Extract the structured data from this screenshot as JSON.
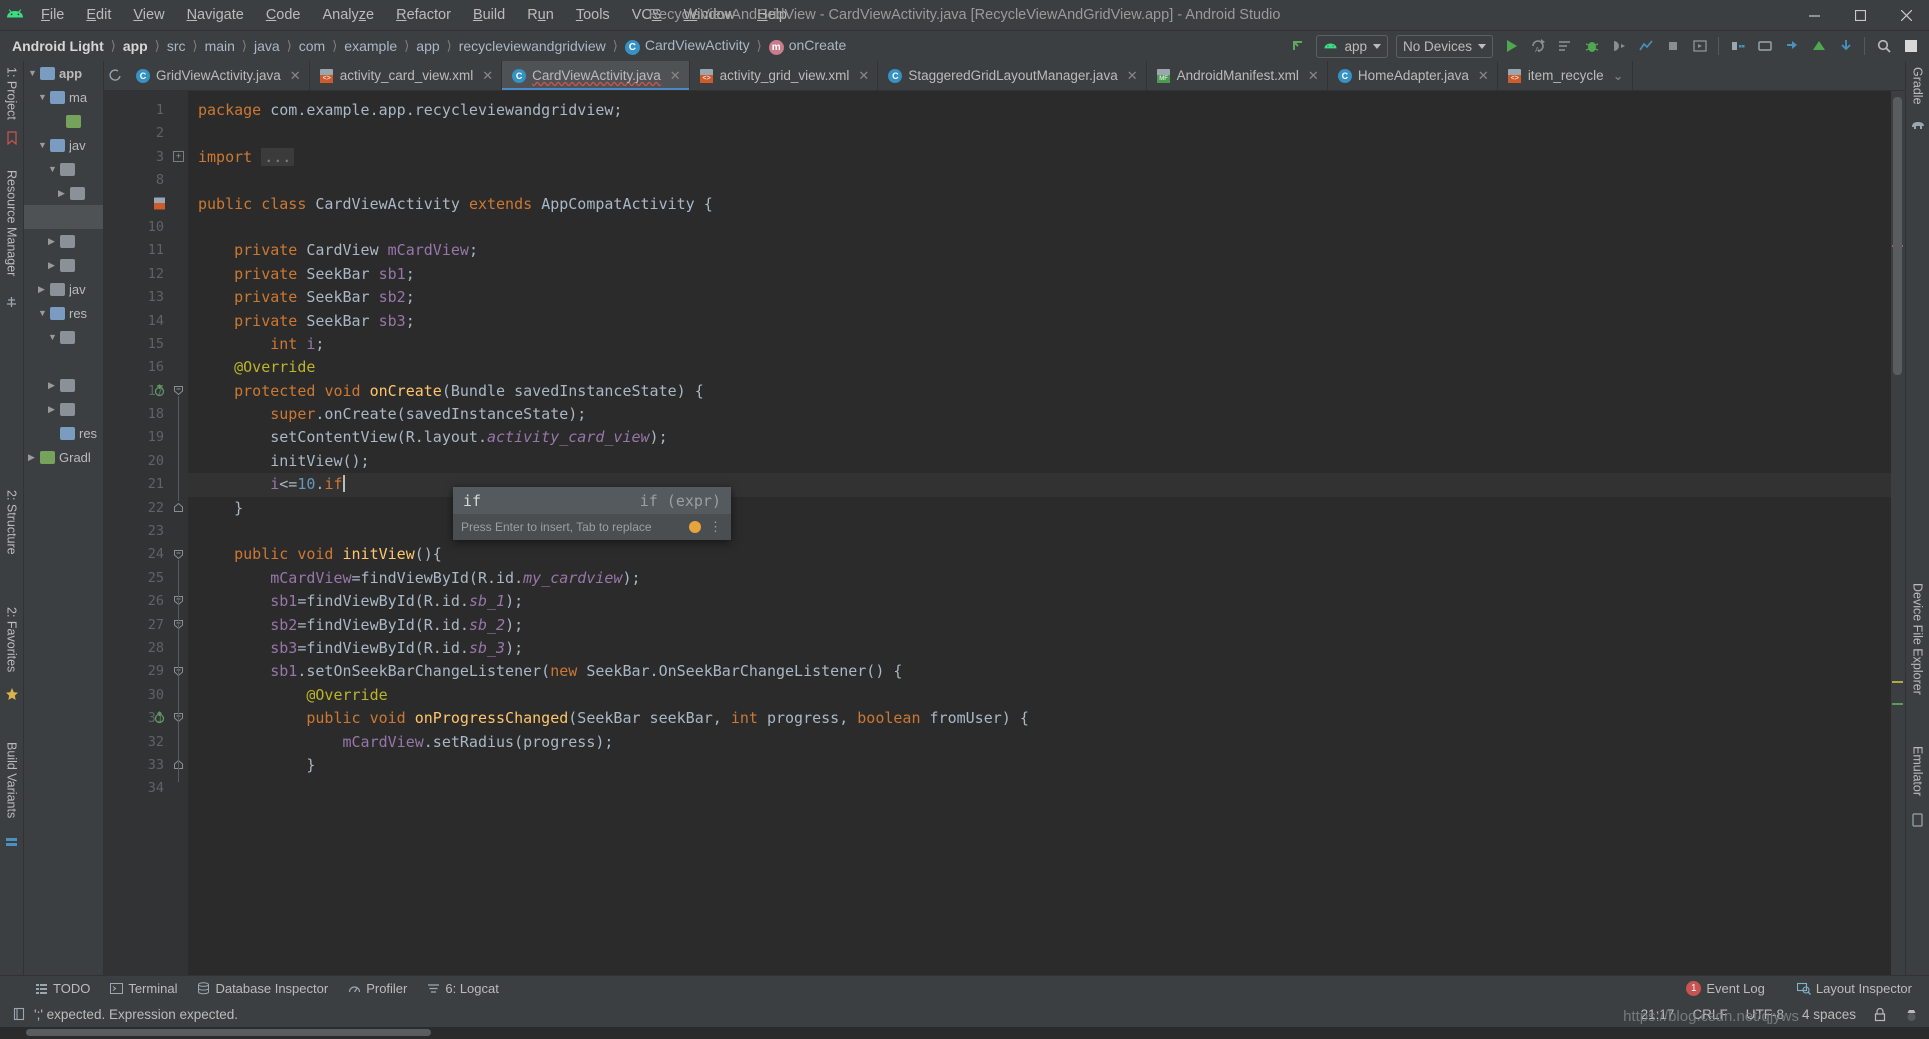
{
  "window": {
    "title": "RecycleViewAndGridView - CardViewActivity.java [RecycleViewAndGridView.app] - Android Studio",
    "minimize": "—",
    "maximize": "☐",
    "close": "✕"
  },
  "menu": {
    "items": [
      {
        "label": "File",
        "mnemonic": "F"
      },
      {
        "label": "Edit",
        "mnemonic": "E"
      },
      {
        "label": "View",
        "mnemonic": "V"
      },
      {
        "label": "Navigate",
        "mnemonic": "N"
      },
      {
        "label": "Code",
        "mnemonic": "C"
      },
      {
        "label": "Analyze",
        "mnemonic": "z"
      },
      {
        "label": "Refactor",
        "mnemonic": "R"
      },
      {
        "label": "Build",
        "mnemonic": "B"
      },
      {
        "label": "Run",
        "mnemonic": "u"
      },
      {
        "label": "Tools",
        "mnemonic": "T"
      },
      {
        "label": "VCS",
        "mnemonic": "S"
      },
      {
        "label": "Window",
        "mnemonic": "W"
      },
      {
        "label": "Help",
        "mnemonic": "H"
      }
    ]
  },
  "breadcrumb": {
    "items": [
      {
        "label": "Android Light",
        "style": "bold"
      },
      {
        "label": "app",
        "style": "bold"
      },
      {
        "label": "src",
        "style": "dim"
      },
      {
        "label": "main",
        "style": "dim"
      },
      {
        "label": "java",
        "style": "dim"
      },
      {
        "label": "com",
        "style": "dim"
      },
      {
        "label": "example",
        "style": "dim"
      },
      {
        "label": "app",
        "style": "dim"
      },
      {
        "label": "recycleviewandgridview",
        "style": "dim"
      },
      {
        "label": "CardViewActivity",
        "style": "dim",
        "icon": "class-icon",
        "icon_glyph": "C"
      },
      {
        "label": "onCreate",
        "style": "dim",
        "icon": "method-icon",
        "icon_glyph": "m"
      }
    ],
    "separator": "〉"
  },
  "toolbar": {
    "module_selector": "app",
    "device_selector": "No Devices",
    "icons": [
      "run-icon",
      "apply-changes-icon",
      "apply-code-changes-icon",
      "debug-icon",
      "attach-debugger-icon",
      "profile-icon",
      "stop-icon",
      "sdk-manager-icon",
      "avd-manager-icon",
      "layout-inspector-icon",
      "sync-gradle-icon",
      "avd-icon",
      "device-explorer-icon",
      "search-everywhere-icon",
      "project-structure-icon"
    ]
  },
  "left_tool_strips": {
    "top": [
      "1: Project"
    ],
    "items": [
      "Resource Manager",
      "2: Structure",
      "2: Favorites",
      "Build Variants"
    ]
  },
  "right_tool_strips": {
    "items": [
      "Gradle",
      "Device File Explorer",
      "Emulator"
    ]
  },
  "project_tree": [
    {
      "label": "app",
      "depth": 0,
      "arrow": "▼",
      "bold": true,
      "folder": "blue"
    },
    {
      "label": "ma",
      "depth": 1,
      "arrow": "▼",
      "folder": "blue"
    },
    {
      "label": "",
      "depth": 2,
      "arrow": "",
      "folder": "green"
    },
    {
      "label": "jav",
      "depth": 1,
      "arrow": "▼",
      "folder": "blue"
    },
    {
      "label": "",
      "depth": 2,
      "arrow": "▼",
      "folder": "plain"
    },
    {
      "label": "",
      "depth": 3,
      "arrow": "▶",
      "folder": "plain"
    },
    {
      "label": "",
      "depth": 2,
      "arrow": "▶",
      "folder": "plain"
    },
    {
      "label": "",
      "depth": 2,
      "arrow": "▶",
      "folder": "plain"
    },
    {
      "label": "jav",
      "depth": 1,
      "arrow": "▶",
      "folder": "plain"
    },
    {
      "label": "res",
      "depth": 1,
      "arrow": "▼",
      "folder": "blue"
    },
    {
      "label": "",
      "depth": 2,
      "arrow": "▼",
      "folder": "plain"
    },
    {
      "label": "",
      "depth": 3,
      "arrow": "",
      "folder": "plain"
    },
    {
      "label": "",
      "depth": 2,
      "arrow": "▶",
      "folder": "plain"
    },
    {
      "label": "",
      "depth": 2,
      "arrow": "▶",
      "folder": "plain"
    },
    {
      "label": "res",
      "depth": 1,
      "arrow": "",
      "folder": "blue"
    },
    {
      "label": "Gradl",
      "depth": 0,
      "arrow": "▶",
      "folder": "gradle"
    }
  ],
  "editor_tabs": [
    {
      "label": "GridViewActivity.java",
      "icon": "java-class-icon",
      "active": false,
      "error": false
    },
    {
      "label": "activity_card_view.xml",
      "icon": "xml-layout-icon",
      "active": false,
      "error": false
    },
    {
      "label": "CardViewActivity.java",
      "icon": "java-class-icon",
      "active": true,
      "error": true
    },
    {
      "label": "activity_grid_view.xml",
      "icon": "xml-layout-icon",
      "active": false,
      "error": false
    },
    {
      "label": "StaggeredGridLayoutManager.java",
      "icon": "java-class-icon",
      "active": false,
      "error": false
    },
    {
      "label": "AndroidManifest.xml",
      "icon": "manifest-icon",
      "active": false,
      "error": false
    },
    {
      "label": "HomeAdapter.java",
      "icon": "java-class-icon",
      "active": false,
      "error": false
    },
    {
      "label": "item_recycle",
      "icon": "xml-layout-icon",
      "active": false,
      "error": false,
      "truncated": true
    }
  ],
  "code": {
    "filename": "CardViewActivity.java",
    "lines": [
      {
        "n": 1,
        "tokens": [
          {
            "t": "package ",
            "c": "kw"
          },
          {
            "t": "com.example.app.recycleviewandgridview;",
            "c": "pl"
          }
        ]
      },
      {
        "n": 2,
        "tokens": []
      },
      {
        "n": 3,
        "tokens": [
          {
            "t": "import ",
            "c": "kw"
          },
          {
            "t": "...",
            "c": "imp"
          }
        ],
        "fold": "collapsed"
      },
      {
        "n": 8,
        "tokens": []
      },
      {
        "n": 9,
        "tokens": [
          {
            "t": "public ",
            "c": "kw"
          },
          {
            "t": "class ",
            "c": "kw"
          },
          {
            "t": "CardViewActivity ",
            "c": "cls"
          },
          {
            "t": "extends ",
            "c": "kw"
          },
          {
            "t": "AppCompatActivity {",
            "c": "cls"
          }
        ],
        "gutter_icon": "layout-file-icon"
      },
      {
        "n": 10,
        "tokens": []
      },
      {
        "n": 11,
        "tokens": [
          {
            "t": "    ",
            "c": "pl"
          },
          {
            "t": "private ",
            "c": "kw"
          },
          {
            "t": "CardView ",
            "c": "cls"
          },
          {
            "t": "mCardView",
            "c": "fld"
          },
          {
            "t": ";",
            "c": "pl"
          }
        ]
      },
      {
        "n": 12,
        "tokens": [
          {
            "t": "    ",
            "c": "pl"
          },
          {
            "t": "private ",
            "c": "kw"
          },
          {
            "t": "SeekBar ",
            "c": "cls"
          },
          {
            "t": "sb1",
            "c": "fld"
          },
          {
            "t": ";",
            "c": "pl"
          }
        ]
      },
      {
        "n": 13,
        "tokens": [
          {
            "t": "    ",
            "c": "pl"
          },
          {
            "t": "private ",
            "c": "kw"
          },
          {
            "t": "SeekBar ",
            "c": "cls"
          },
          {
            "t": "sb2",
            "c": "fld"
          },
          {
            "t": ";",
            "c": "pl"
          }
        ]
      },
      {
        "n": 14,
        "tokens": [
          {
            "t": "    ",
            "c": "pl"
          },
          {
            "t": "private ",
            "c": "kw"
          },
          {
            "t": "SeekBar ",
            "c": "cls"
          },
          {
            "t": "sb3",
            "c": "fld"
          },
          {
            "t": ";",
            "c": "pl"
          }
        ]
      },
      {
        "n": 15,
        "tokens": [
          {
            "t": "        ",
            "c": "pl"
          },
          {
            "t": "int ",
            "c": "kw"
          },
          {
            "t": "i",
            "c": "fld"
          },
          {
            "t": ";",
            "c": "pl"
          }
        ]
      },
      {
        "n": 16,
        "tokens": [
          {
            "t": "    ",
            "c": "pl"
          },
          {
            "t": "@Override",
            "c": "ann"
          }
        ]
      },
      {
        "n": 17,
        "tokens": [
          {
            "t": "    ",
            "c": "pl"
          },
          {
            "t": "protected ",
            "c": "kw"
          },
          {
            "t": "void ",
            "c": "kw"
          },
          {
            "t": "onCreate",
            "c": "mth"
          },
          {
            "t": "(Bundle savedInstanceState) {",
            "c": "pl"
          }
        ],
        "gutter_icon": "override-method-icon",
        "fold": "open"
      },
      {
        "n": 18,
        "tokens": [
          {
            "t": "        ",
            "c": "pl"
          },
          {
            "t": "super",
            "c": "kw"
          },
          {
            "t": ".onCreate(savedInstanceState);",
            "c": "pl"
          }
        ]
      },
      {
        "n": 19,
        "tokens": [
          {
            "t": "        setContentView(R.layout.",
            "c": "pl"
          },
          {
            "t": "activity_card_view",
            "c": "fldi"
          },
          {
            "t": ");",
            "c": "pl"
          }
        ]
      },
      {
        "n": 20,
        "tokens": [
          {
            "t": "        initView();",
            "c": "pl"
          }
        ]
      },
      {
        "n": 21,
        "tokens": [
          {
            "t": "        ",
            "c": "pl"
          },
          {
            "t": "i",
            "c": "fld"
          },
          {
            "t": "<=",
            "c": "pl"
          },
          {
            "t": "10",
            "c": "num"
          },
          {
            "t": ".",
            "c": "pl"
          },
          {
            "t": "if",
            "c": "kw"
          }
        ],
        "current": true
      },
      {
        "n": 22,
        "tokens": [
          {
            "t": "    }",
            "c": "pl"
          }
        ],
        "fold": "close"
      },
      {
        "n": 23,
        "tokens": []
      },
      {
        "n": 24,
        "tokens": [
          {
            "t": "    ",
            "c": "pl"
          },
          {
            "t": "public ",
            "c": "kw"
          },
          {
            "t": "void ",
            "c": "kw"
          },
          {
            "t": "initView",
            "c": "mth"
          },
          {
            "t": "(){",
            "c": "pl"
          }
        ],
        "fold": "open"
      },
      {
        "n": 25,
        "tokens": [
          {
            "t": "        ",
            "c": "pl"
          },
          {
            "t": "mCardView",
            "c": "fld"
          },
          {
            "t": "=findViewById(R.id.",
            "c": "pl"
          },
          {
            "t": "my_cardview",
            "c": "fldi"
          },
          {
            "t": ");",
            "c": "pl"
          }
        ]
      },
      {
        "n": 26,
        "tokens": [
          {
            "t": "        ",
            "c": "pl"
          },
          {
            "t": "sb1",
            "c": "fld"
          },
          {
            "t": "=findViewById(R.id.",
            "c": "pl"
          },
          {
            "t": "sb_1",
            "c": "fldi"
          },
          {
            "t": ");",
            "c": "pl"
          }
        ],
        "fold": "open"
      },
      {
        "n": 27,
        "tokens": [
          {
            "t": "        ",
            "c": "pl"
          },
          {
            "t": "sb2",
            "c": "fld"
          },
          {
            "t": "=findViewById(R.id.",
            "c": "pl"
          },
          {
            "t": "sb_2",
            "c": "fldi"
          },
          {
            "t": ");",
            "c": "pl"
          }
        ],
        "fold": "open"
      },
      {
        "n": 28,
        "tokens": [
          {
            "t": "        ",
            "c": "pl"
          },
          {
            "t": "sb3",
            "c": "fld"
          },
          {
            "t": "=findViewById(R.id.",
            "c": "pl"
          },
          {
            "t": "sb_3",
            "c": "fldi"
          },
          {
            "t": ");",
            "c": "pl"
          }
        ]
      },
      {
        "n": 29,
        "tokens": [
          {
            "t": "        ",
            "c": "pl"
          },
          {
            "t": "sb1",
            "c": "fld"
          },
          {
            "t": ".setOnSeekBarChangeListener(",
            "c": "pl"
          },
          {
            "t": "new ",
            "c": "kw"
          },
          {
            "t": "SeekBar.OnSeekBarChangeListener() {",
            "c": "pl"
          }
        ],
        "fold": "open"
      },
      {
        "n": 30,
        "tokens": [
          {
            "t": "            ",
            "c": "pl"
          },
          {
            "t": "@Override",
            "c": "ann"
          }
        ]
      },
      {
        "n": 31,
        "tokens": [
          {
            "t": "            ",
            "c": "pl"
          },
          {
            "t": "public ",
            "c": "kw"
          },
          {
            "t": "void ",
            "c": "kw"
          },
          {
            "t": "onProgressChanged",
            "c": "mth"
          },
          {
            "t": "(SeekBar seekBar, ",
            "c": "pl"
          },
          {
            "t": "int ",
            "c": "kw"
          },
          {
            "t": "progress, ",
            "c": "pl"
          },
          {
            "t": "boolean ",
            "c": "kw"
          },
          {
            "t": "fromUser) {",
            "c": "pl"
          }
        ],
        "gutter_icon": "override-method-icon",
        "fold": "open"
      },
      {
        "n": 32,
        "tokens": [
          {
            "t": "                ",
            "c": "pl"
          },
          {
            "t": "mCardView",
            "c": "fld"
          },
          {
            "t": ".setRadius(progress);",
            "c": "pl"
          }
        ]
      },
      {
        "n": 33,
        "tokens": [
          {
            "t": "            }",
            "c": "pl"
          }
        ],
        "fold": "close"
      },
      {
        "n": 34,
        "tokens": []
      }
    ]
  },
  "completion_popup": {
    "item": "if",
    "tail": "if (expr)",
    "hint": "Press Enter to insert, Tab to replace",
    "bulb_icon": "intention-bulb-icon",
    "more_icon": "more-options-icon"
  },
  "bottom_bar": {
    "items": [
      {
        "label": "TODO",
        "icon": "todo-icon"
      },
      {
        "label": "Terminal",
        "icon": "terminal-icon"
      },
      {
        "label": "Database Inspector",
        "icon": "database-icon"
      },
      {
        "label": "Profiler",
        "icon": "profiler-icon"
      },
      {
        "label": "6: Logcat",
        "icon": "logcat-icon"
      }
    ],
    "right": [
      {
        "label": "Event Log",
        "icon": "event-log-icon",
        "badge": "1"
      },
      {
        "label": "Layout Inspector",
        "icon": "layout-inspector-icon"
      }
    ]
  },
  "status_bar": {
    "message": "';' expected. Expression expected.",
    "message_icon": "editor-notification-icon",
    "position": "21:17",
    "line_separator": "CRLF",
    "encoding": "UTF-8",
    "indent": "4 spaces",
    "lock_icon": "read-only-lock-icon",
    "inspection_icon": "inspections-icon"
  },
  "watermark": "https://blog.csdn.net/qjyws",
  "colors": {
    "chrome": "#3c3f41",
    "editor_bg": "#2b2b2b",
    "gutter_bg": "#313335",
    "accent_blue": "#4a88c7",
    "keyword_orange": "#cc7832",
    "field_purple": "#9876aa",
    "method_yellow": "#ffc66d",
    "annotation_olive": "#bbb529",
    "number_blue": "#6897bb",
    "error_red": "#c75450",
    "android_green": "#3ddc84"
  }
}
